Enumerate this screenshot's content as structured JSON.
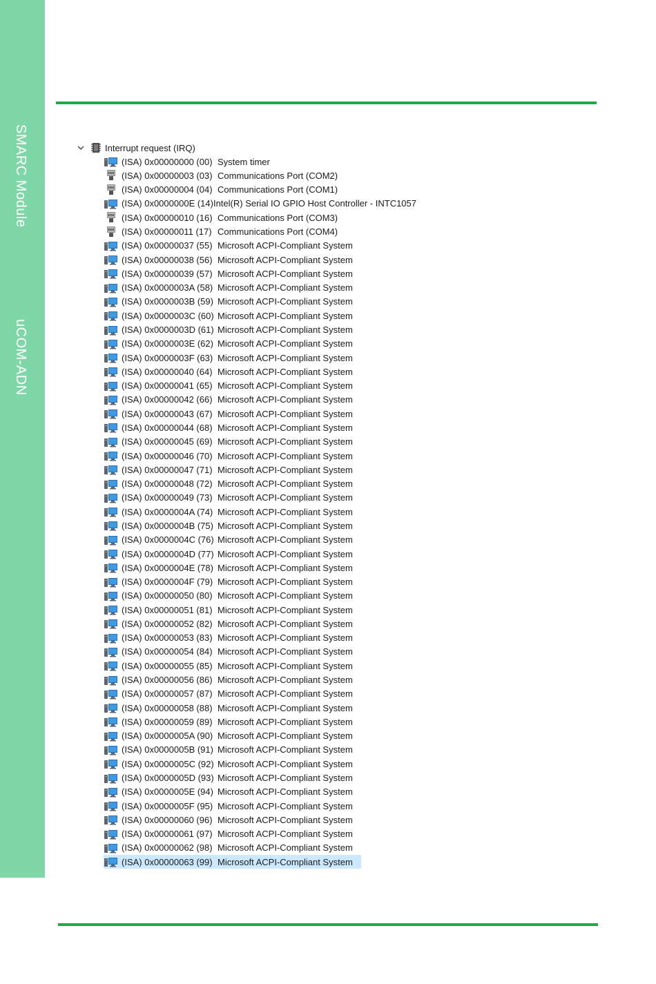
{
  "sidebar": {
    "label_top": "SMARC Module",
    "label_bottom": "uCOM-ADN"
  },
  "colors": {
    "band": "#7fd6a6",
    "rule": "#1ba94c",
    "selected": "#cce8ff"
  },
  "tree": {
    "root_label": "Interrupt request (IRQ)",
    "root_icon": "chip-icon",
    "items": [
      {
        "irq": "(ISA) 0x00000000 (00)",
        "device": "System timer",
        "icon": "system-device-icon"
      },
      {
        "irq": "(ISA) 0x00000003 (03)",
        "device": "Communications Port (COM2)",
        "icon": "port-icon"
      },
      {
        "irq": "(ISA) 0x00000004 (04)",
        "device": "Communications Port (COM1)",
        "icon": "port-icon"
      },
      {
        "irq": "(ISA) 0x0000000E (14)",
        "device": "Intel(R) Serial IO GPIO Host Controller - INTC1057",
        "icon": "system-device-icon"
      },
      {
        "irq": "(ISA) 0x00000010 (16)",
        "device": "Communications Port (COM3)",
        "icon": "port-icon"
      },
      {
        "irq": "(ISA) 0x00000011 (17)",
        "device": "Communications Port (COM4)",
        "icon": "port-icon"
      },
      {
        "irq": "(ISA) 0x00000037 (55)",
        "device": "Microsoft ACPI-Compliant System",
        "icon": "system-device-icon"
      },
      {
        "irq": "(ISA) 0x00000038 (56)",
        "device": "Microsoft ACPI-Compliant System",
        "icon": "system-device-icon"
      },
      {
        "irq": "(ISA) 0x00000039 (57)",
        "device": "Microsoft ACPI-Compliant System",
        "icon": "system-device-icon"
      },
      {
        "irq": "(ISA) 0x0000003A (58)",
        "device": "Microsoft ACPI-Compliant System",
        "icon": "system-device-icon"
      },
      {
        "irq": "(ISA) 0x0000003B (59)",
        "device": "Microsoft ACPI-Compliant System",
        "icon": "system-device-icon"
      },
      {
        "irq": "(ISA) 0x0000003C (60)",
        "device": "Microsoft ACPI-Compliant System",
        "icon": "system-device-icon"
      },
      {
        "irq": "(ISA) 0x0000003D (61)",
        "device": "Microsoft ACPI-Compliant System",
        "icon": "system-device-icon"
      },
      {
        "irq": "(ISA) 0x0000003E (62)",
        "device": "Microsoft ACPI-Compliant System",
        "icon": "system-device-icon"
      },
      {
        "irq": "(ISA) 0x0000003F (63)",
        "device": "Microsoft ACPI-Compliant System",
        "icon": "system-device-icon"
      },
      {
        "irq": "(ISA) 0x00000040 (64)",
        "device": "Microsoft ACPI-Compliant System",
        "icon": "system-device-icon"
      },
      {
        "irq": "(ISA) 0x00000041 (65)",
        "device": "Microsoft ACPI-Compliant System",
        "icon": "system-device-icon"
      },
      {
        "irq": "(ISA) 0x00000042 (66)",
        "device": "Microsoft ACPI-Compliant System",
        "icon": "system-device-icon"
      },
      {
        "irq": "(ISA) 0x00000043 (67)",
        "device": "Microsoft ACPI-Compliant System",
        "icon": "system-device-icon"
      },
      {
        "irq": "(ISA) 0x00000044 (68)",
        "device": "Microsoft ACPI-Compliant System",
        "icon": "system-device-icon"
      },
      {
        "irq": "(ISA) 0x00000045 (69)",
        "device": "Microsoft ACPI-Compliant System",
        "icon": "system-device-icon"
      },
      {
        "irq": "(ISA) 0x00000046 (70)",
        "device": "Microsoft ACPI-Compliant System",
        "icon": "system-device-icon"
      },
      {
        "irq": "(ISA) 0x00000047 (71)",
        "device": "Microsoft ACPI-Compliant System",
        "icon": "system-device-icon"
      },
      {
        "irq": "(ISA) 0x00000048 (72)",
        "device": "Microsoft ACPI-Compliant System",
        "icon": "system-device-icon"
      },
      {
        "irq": "(ISA) 0x00000049 (73)",
        "device": "Microsoft ACPI-Compliant System",
        "icon": "system-device-icon"
      },
      {
        "irq": "(ISA) 0x0000004A (74)",
        "device": "Microsoft ACPI-Compliant System",
        "icon": "system-device-icon"
      },
      {
        "irq": "(ISA) 0x0000004B (75)",
        "device": "Microsoft ACPI-Compliant System",
        "icon": "system-device-icon"
      },
      {
        "irq": "(ISA) 0x0000004C (76)",
        "device": "Microsoft ACPI-Compliant System",
        "icon": "system-device-icon"
      },
      {
        "irq": "(ISA) 0x0000004D (77)",
        "device": "Microsoft ACPI-Compliant System",
        "icon": "system-device-icon"
      },
      {
        "irq": "(ISA) 0x0000004E (78)",
        "device": "Microsoft ACPI-Compliant System",
        "icon": "system-device-icon"
      },
      {
        "irq": "(ISA) 0x0000004F (79)",
        "device": "Microsoft ACPI-Compliant System",
        "icon": "system-device-icon"
      },
      {
        "irq": "(ISA) 0x00000050 (80)",
        "device": "Microsoft ACPI-Compliant System",
        "icon": "system-device-icon"
      },
      {
        "irq": "(ISA) 0x00000051 (81)",
        "device": "Microsoft ACPI-Compliant System",
        "icon": "system-device-icon"
      },
      {
        "irq": "(ISA) 0x00000052 (82)",
        "device": "Microsoft ACPI-Compliant System",
        "icon": "system-device-icon"
      },
      {
        "irq": "(ISA) 0x00000053 (83)",
        "device": "Microsoft ACPI-Compliant System",
        "icon": "system-device-icon"
      },
      {
        "irq": "(ISA) 0x00000054 (84)",
        "device": "Microsoft ACPI-Compliant System",
        "icon": "system-device-icon"
      },
      {
        "irq": "(ISA) 0x00000055 (85)",
        "device": "Microsoft ACPI-Compliant System",
        "icon": "system-device-icon"
      },
      {
        "irq": "(ISA) 0x00000056 (86)",
        "device": "Microsoft ACPI-Compliant System",
        "icon": "system-device-icon"
      },
      {
        "irq": "(ISA) 0x00000057 (87)",
        "device": "Microsoft ACPI-Compliant System",
        "icon": "system-device-icon"
      },
      {
        "irq": "(ISA) 0x00000058 (88)",
        "device": "Microsoft ACPI-Compliant System",
        "icon": "system-device-icon"
      },
      {
        "irq": "(ISA) 0x00000059 (89)",
        "device": "Microsoft ACPI-Compliant System",
        "icon": "system-device-icon"
      },
      {
        "irq": "(ISA) 0x0000005A (90)",
        "device": "Microsoft ACPI-Compliant System",
        "icon": "system-device-icon"
      },
      {
        "irq": "(ISA) 0x0000005B (91)",
        "device": "Microsoft ACPI-Compliant System",
        "icon": "system-device-icon"
      },
      {
        "irq": "(ISA) 0x0000005C (92)",
        "device": "Microsoft ACPI-Compliant System",
        "icon": "system-device-icon"
      },
      {
        "irq": "(ISA) 0x0000005D (93)",
        "device": "Microsoft ACPI-Compliant System",
        "icon": "system-device-icon"
      },
      {
        "irq": "(ISA) 0x0000005E (94)",
        "device": "Microsoft ACPI-Compliant System",
        "icon": "system-device-icon"
      },
      {
        "irq": "(ISA) 0x0000005F (95)",
        "device": "Microsoft ACPI-Compliant System",
        "icon": "system-device-icon"
      },
      {
        "irq": "(ISA) 0x00000060 (96)",
        "device": "Microsoft ACPI-Compliant System",
        "icon": "system-device-icon"
      },
      {
        "irq": "(ISA) 0x00000061 (97)",
        "device": "Microsoft ACPI-Compliant System",
        "icon": "system-device-icon"
      },
      {
        "irq": "(ISA) 0x00000062 (98)",
        "device": "Microsoft ACPI-Compliant System",
        "icon": "system-device-icon"
      },
      {
        "irq": "(ISA) 0x00000063 (99)",
        "device": "Microsoft ACPI-Compliant System",
        "icon": "system-device-icon",
        "selected": true
      }
    ]
  }
}
